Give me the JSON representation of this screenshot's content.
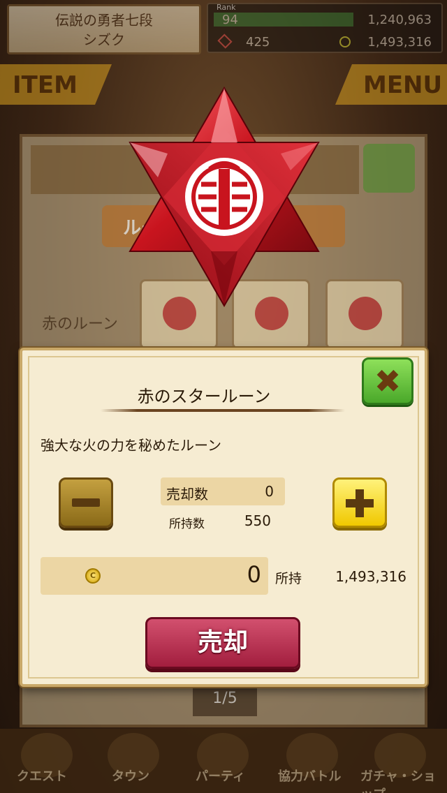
{
  "status": {
    "player_title": "伝説の勇者七段",
    "player_name": "シズク",
    "rank_label": "Rank",
    "rank": "94",
    "exp": "1,240,963",
    "gems": "425",
    "coins": "1,493,316"
  },
  "tabs": {
    "item": "ITEM",
    "menu": "MENU"
  },
  "background": {
    "tab_label": "ルーン　アイテム",
    "row_label": "赤のルーン",
    "pager": "1/5",
    "nav": [
      "クエスト",
      "タウン",
      "パーティ",
      "協力バトル",
      "ガチャ・ショップ"
    ]
  },
  "dialog": {
    "title": "赤のスタールーン",
    "description": "強大な火の力を秘めたルーン",
    "sell_count_label": "売却数",
    "sell_count": "0",
    "owned_label": "所持数",
    "owned": "550",
    "price": "0",
    "coin_symbol": "C",
    "held_label": "所持",
    "held_coins": "1,493,316",
    "sell_button": "売却"
  },
  "colors": {
    "rune_red": "#c8141e",
    "sell_button": "#b42848",
    "close_button": "#5cbc34",
    "plus_button": "#f6d820",
    "minus_button": "#a8862a"
  }
}
